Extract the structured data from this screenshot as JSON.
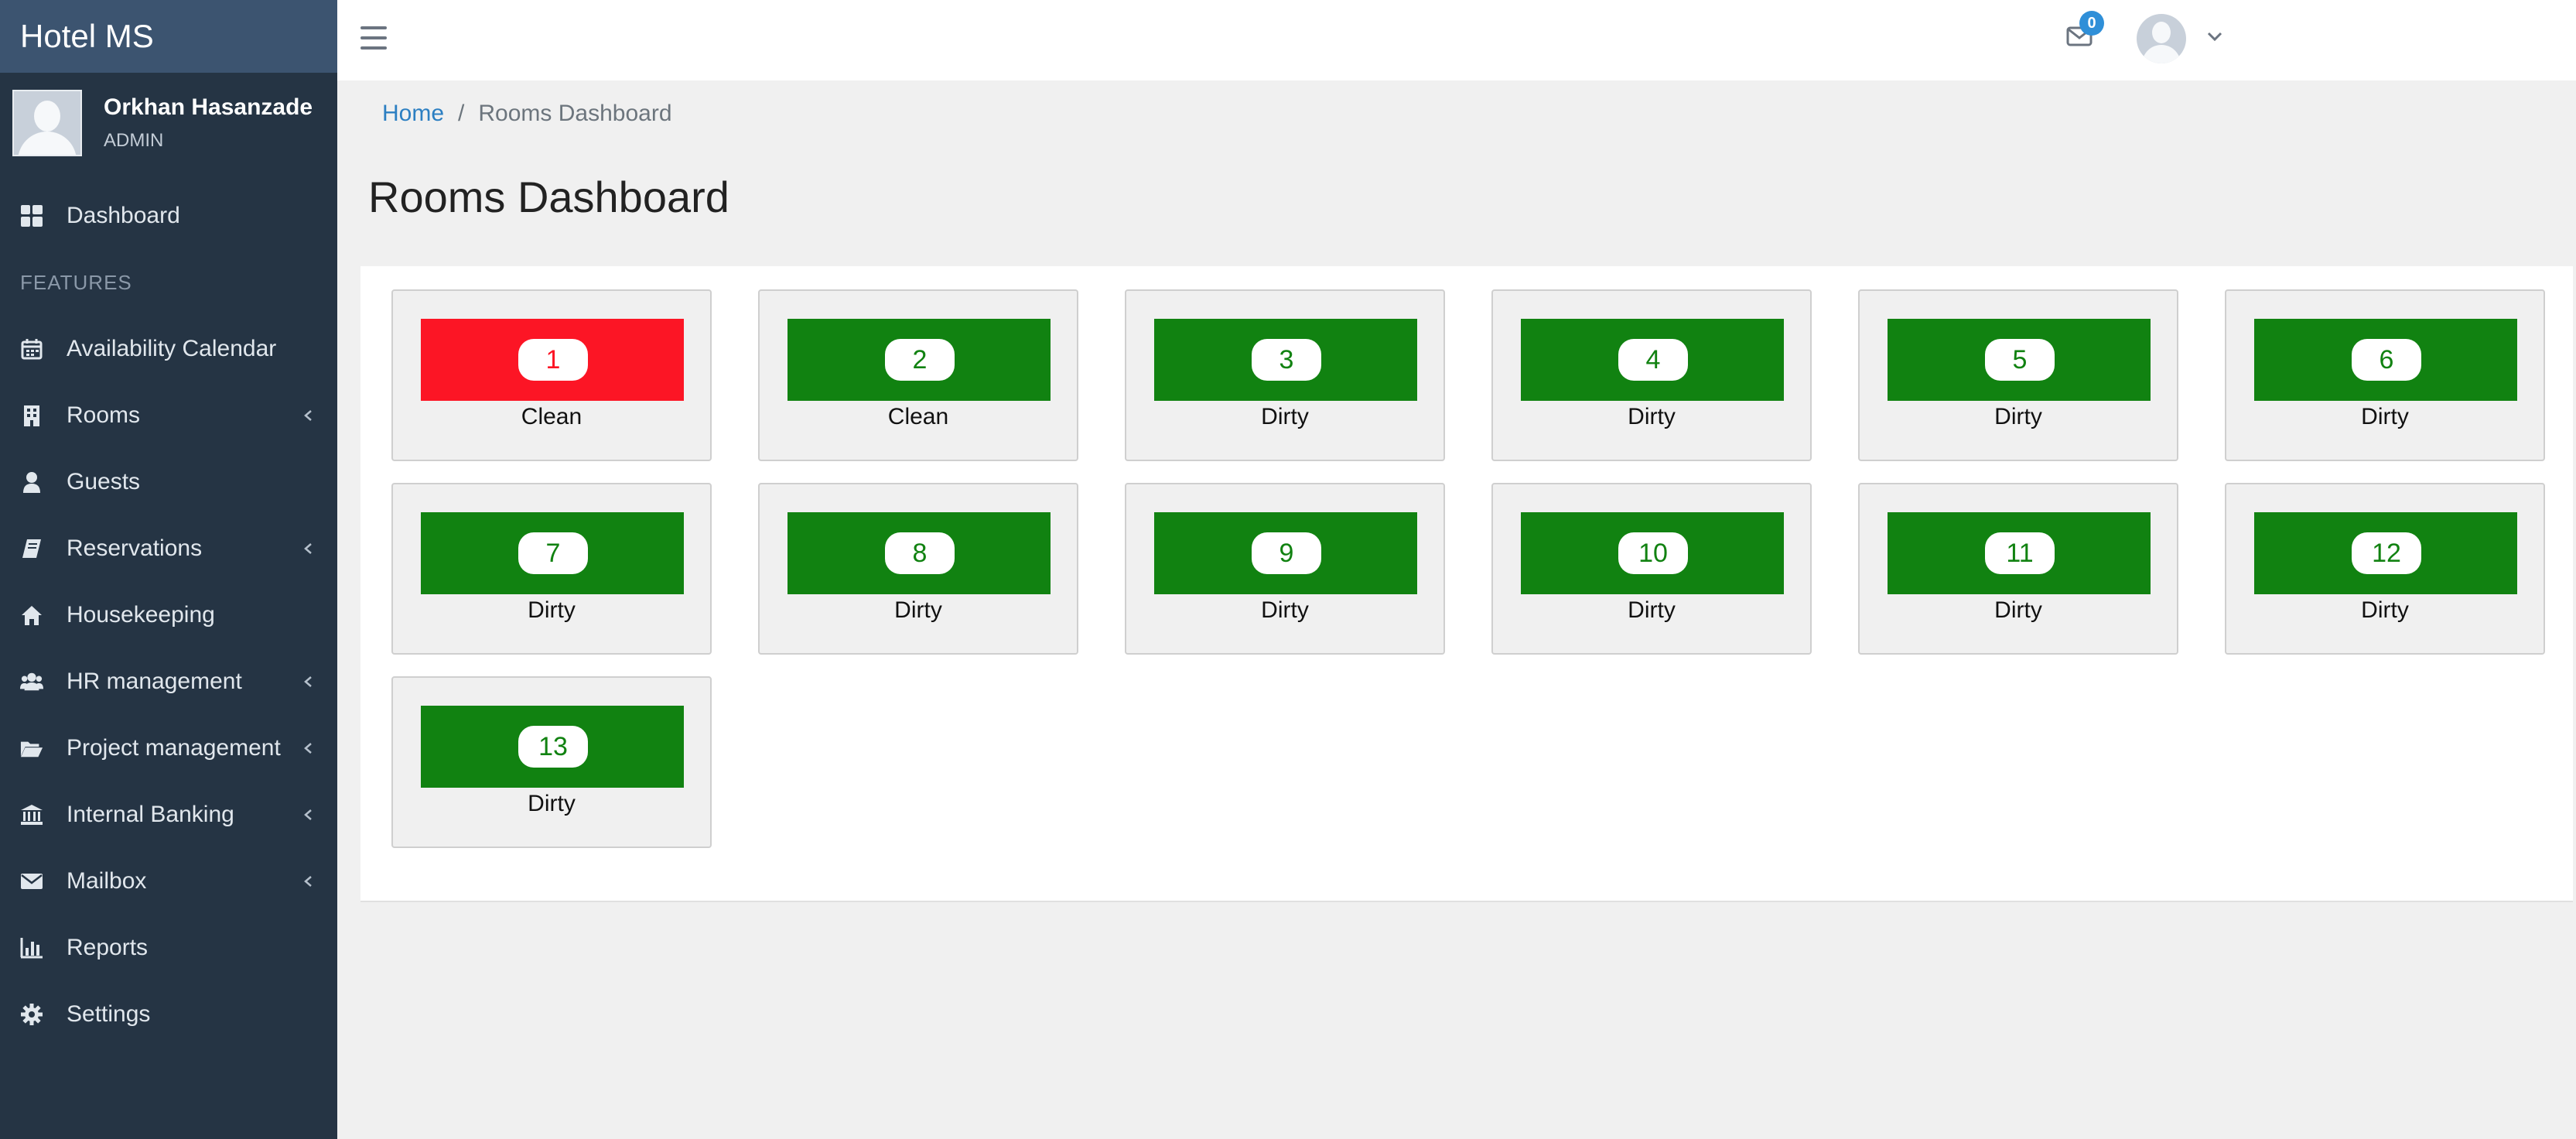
{
  "app": {
    "brand": "Hotel MS"
  },
  "user": {
    "name": "Orkhan Hasanzade",
    "role": "ADMIN"
  },
  "sidebar": {
    "dashboard": "Dashboard",
    "section": "FEATURES",
    "items": [
      {
        "label": "Availability Calendar",
        "icon": "calendar-icon",
        "chevron": false
      },
      {
        "label": "Rooms",
        "icon": "building-icon",
        "chevron": true
      },
      {
        "label": "Guests",
        "icon": "user-icon",
        "chevron": false
      },
      {
        "label": "Reservations",
        "icon": "book-icon",
        "chevron": true
      },
      {
        "label": "Housekeeping",
        "icon": "home-icon",
        "chevron": false
      },
      {
        "label": "HR management",
        "icon": "users-icon",
        "chevron": true
      },
      {
        "label": "Project management",
        "icon": "folder-open-icon",
        "chevron": true
      },
      {
        "label": "Internal Banking",
        "icon": "bank-icon",
        "chevron": true
      },
      {
        "label": "Mailbox",
        "icon": "envelope-icon",
        "chevron": true
      },
      {
        "label": "Reports",
        "icon": "bar-chart-icon",
        "chevron": false
      },
      {
        "label": "Settings",
        "icon": "gear-icon",
        "chevron": false
      }
    ]
  },
  "topbar": {
    "mail_count": "0"
  },
  "breadcrumb": {
    "home": "Home",
    "separator": "/",
    "current": "Rooms Dashboard"
  },
  "page": {
    "title": "Rooms Dashboard"
  },
  "colors": {
    "clean": "#fc1525",
    "dirty": "#118211"
  },
  "rooms": [
    {
      "number": "1",
      "status": "Clean",
      "color": "red"
    },
    {
      "number": "2",
      "status": "Clean",
      "color": "green"
    },
    {
      "number": "3",
      "status": "Dirty",
      "color": "green"
    },
    {
      "number": "4",
      "status": "Dirty",
      "color": "green"
    },
    {
      "number": "5",
      "status": "Dirty",
      "color": "green"
    },
    {
      "number": "6",
      "status": "Dirty",
      "color": "green"
    },
    {
      "number": "7",
      "status": "Dirty",
      "color": "green"
    },
    {
      "number": "8",
      "status": "Dirty",
      "color": "green"
    },
    {
      "number": "9",
      "status": "Dirty",
      "color": "green"
    },
    {
      "number": "10",
      "status": "Dirty",
      "color": "green"
    },
    {
      "number": "11",
      "status": "Dirty",
      "color": "green"
    },
    {
      "number": "12",
      "status": "Dirty",
      "color": "green"
    },
    {
      "number": "13",
      "status": "Dirty",
      "color": "green"
    }
  ]
}
